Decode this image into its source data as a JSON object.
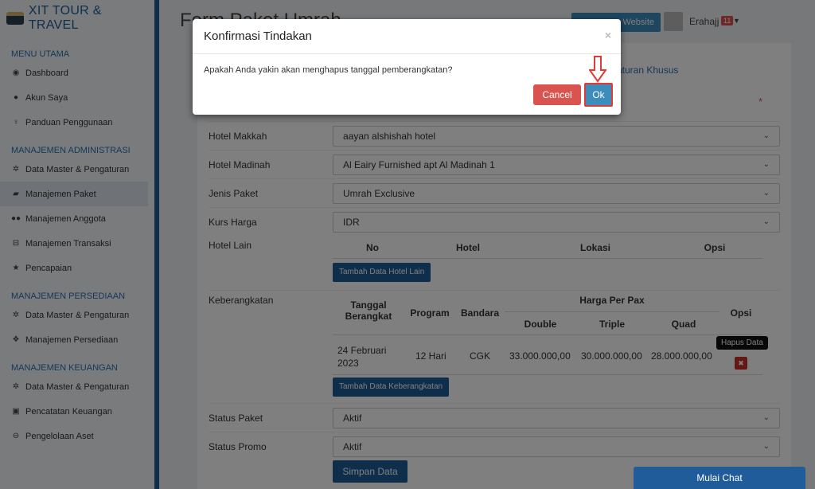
{
  "sidebar": {
    "brand": "XIT TOUR & TRAVEL",
    "sections": [
      {
        "title": "MENU UTAMA",
        "items": [
          {
            "label": "Dashboard",
            "icon": "globe-icon"
          },
          {
            "label": "Akun Saya",
            "icon": "user-icon"
          },
          {
            "label": "Panduan Penggunaan",
            "icon": "lightbulb-icon"
          }
        ]
      },
      {
        "title": "MANAJEMEN ADMINISTRASI",
        "items": [
          {
            "label": "Data Master & Pengaturan",
            "icon": "cogs-icon"
          },
          {
            "label": "Manajemen Paket",
            "icon": "book-icon"
          },
          {
            "label": "Manajemen Anggota",
            "icon": "users-icon"
          },
          {
            "label": "Manajemen Transaksi",
            "icon": "cart-icon"
          },
          {
            "label": "Pencapaian",
            "icon": "star-icon"
          }
        ]
      },
      {
        "title": "MANAJEMEN PERSEDIAAN",
        "items": [
          {
            "label": "Data Master & Pengaturan",
            "icon": "cogs-icon"
          },
          {
            "label": "Manajemen Persediaan",
            "icon": "cubes-icon"
          }
        ]
      },
      {
        "title": "MANAJEMEN KEUANGAN",
        "items": [
          {
            "label": "Data Master & Pengaturan",
            "icon": "cogs-icon"
          },
          {
            "label": "Pencatatan Keuangan",
            "icon": "money-icon"
          },
          {
            "label": "Pengelolaan Aset",
            "icon": "drive-icon"
          }
        ]
      }
    ]
  },
  "header": {
    "page_title": "Form Paket Umrah",
    "website_button": "Website",
    "username": "Erahajj",
    "notif_count": "11"
  },
  "form": {
    "tab_link": "aturan Khusus",
    "hotel_makkah": {
      "label": "Hotel Makkah",
      "value": "aayan alshishah hotel"
    },
    "hotel_madinah": {
      "label": "Hotel Madinah",
      "value": "Al Eairy Furnished apt Al Madinah 1"
    },
    "jenis_paket": {
      "label": "Jenis Paket",
      "value": "Umrah Exclusive"
    },
    "kurs_harga": {
      "label": "Kurs Harga",
      "value": "IDR"
    },
    "hotel_lain": {
      "label": "Hotel Lain",
      "columns": [
        "No",
        "Hotel",
        "Lokasi",
        "Opsi"
      ],
      "add_button": "Tambah Data Hotel Lain"
    },
    "keberangkatan": {
      "label": "Keberangkatan",
      "headers": {
        "tanggal": "Tanggal Berangkat",
        "program": "Program",
        "bandara": "Bandara",
        "harga": "Harga Per Pax",
        "double": "Double",
        "triple": "Triple",
        "quad": "Quad",
        "opsi": "Opsi"
      },
      "rows": [
        {
          "tanggal": "24 Februari 2023",
          "program": "12 Hari",
          "bandara": "CGK",
          "double": "33.000.000,00",
          "triple": "30.000.000,00",
          "quad": "28.000.000,00"
        }
      ],
      "tooltip": "Hapus Data",
      "add_button": "Tambah Data Keberangkatan"
    },
    "status_paket": {
      "label": "Status Paket",
      "value": "Aktif"
    },
    "status_promo": {
      "label": "Status Promo",
      "value": "Aktif"
    },
    "save_button": "Simpan Data"
  },
  "chat_button": "Mulai Chat",
  "modal": {
    "title": "Konfirmasi Tindakan",
    "message": "Apakah Anda yakin akan menghapus tanggal pemberangkatan?",
    "cancel_label": "Cancel",
    "ok_label": "Ok",
    "close_symbol": "×"
  },
  "colors": {
    "primary": "#1f5c99",
    "danger": "#d9534f",
    "highlight": "#e53935"
  }
}
